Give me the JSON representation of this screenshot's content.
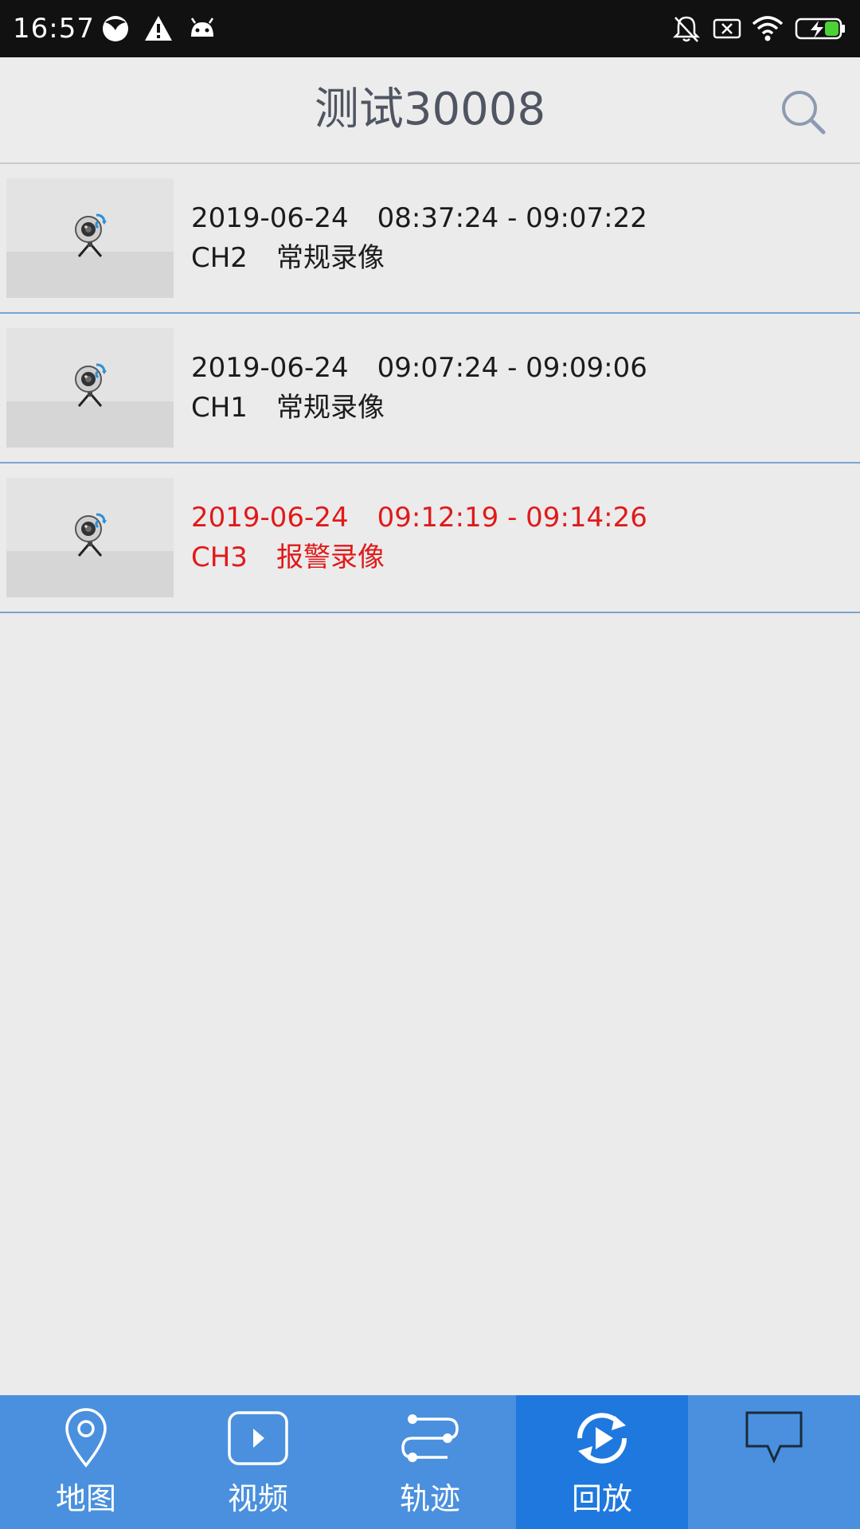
{
  "status_bar": {
    "time": "16:57"
  },
  "header": {
    "title": "测试30008"
  },
  "records": [
    {
      "date": "2019-06-24",
      "time_range": "08:37:24 - 09:07:22",
      "channel": "CH2",
      "type": "常规录像",
      "alarm": false
    },
    {
      "date": "2019-06-24",
      "time_range": "09:07:24 - 09:09:06",
      "channel": "CH1",
      "type": "常规录像",
      "alarm": false
    },
    {
      "date": "2019-06-24",
      "time_range": "09:12:19 - 09:14:26",
      "channel": "CH3",
      "type": "报警录像",
      "alarm": true
    }
  ],
  "nav": {
    "tabs": [
      {
        "label": "地图",
        "icon": "map-pin-icon"
      },
      {
        "label": "视频",
        "icon": "video-play-icon"
      },
      {
        "label": "轨迹",
        "icon": "track-icon"
      },
      {
        "label": "回放",
        "icon": "playback-icon",
        "active": true
      },
      {
        "label": "",
        "icon": "message-icon"
      }
    ]
  },
  "colors": {
    "nav_bg": "#4a90de",
    "nav_active": "#1f78de",
    "alarm_text": "#e01a1a",
    "row_divider": "#7aa4cf"
  }
}
